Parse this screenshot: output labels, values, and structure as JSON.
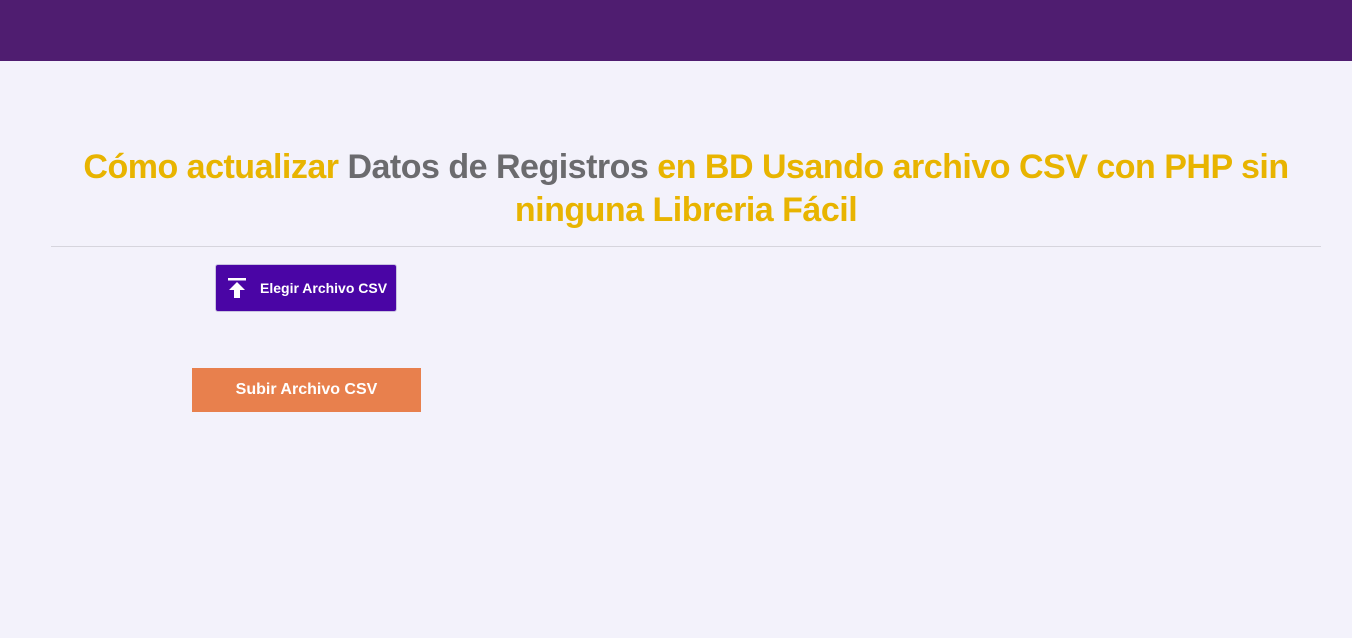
{
  "header": {
    "title_parts": [
      "Cómo actualizar",
      "Datos de Registros",
      "en BD Usando archivo CSV con PHP sin ninguna Libreria Fácil"
    ]
  },
  "upload": {
    "choose_label": "Elegir Archivo CSV",
    "choose_icon": "upload-icon",
    "submit_label": "Subir Archivo CSV"
  },
  "colors": {
    "topbar": "#4f1d70",
    "background": "#f3f2fb",
    "title_accent": "#e8b400",
    "title_muted": "#6b6b6e",
    "choose_button": "#4a05a5",
    "submit_button": "#e8804d"
  }
}
